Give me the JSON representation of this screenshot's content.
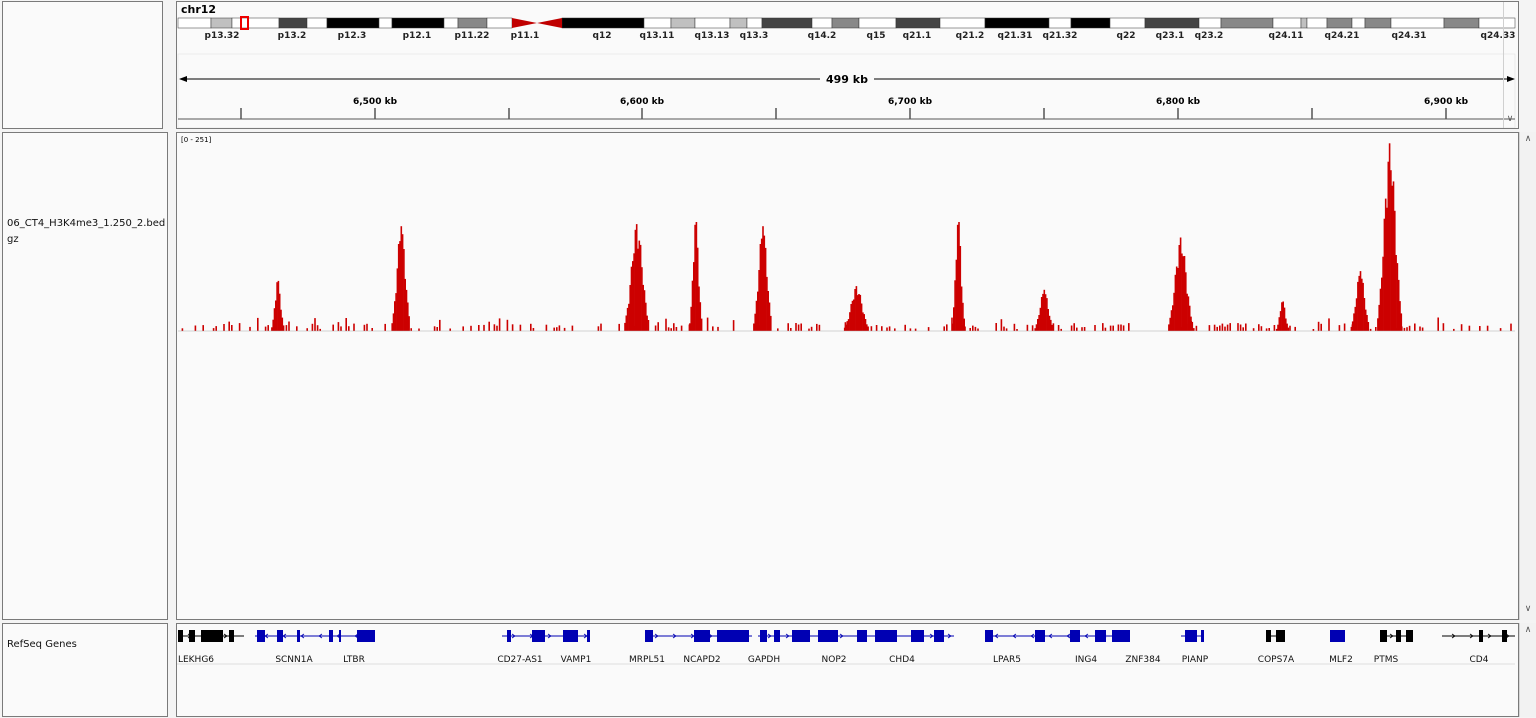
{
  "chromosome": "chr12",
  "ideogram": {
    "labels": [
      "p13.32",
      "p13.2",
      "p12.3",
      "p12.1",
      "p11.22",
      "p11.1",
      "q12",
      "q13.11",
      "q13.13",
      "q13.3",
      "q14.2",
      "q15",
      "q21.1",
      "q21.2",
      "q21.31",
      "q21.32",
      "q22",
      "q23.1",
      "q23.2",
      "q24.11",
      "q24.21",
      "q24.31",
      "q24.33"
    ]
  },
  "ruler": {
    "span_label": "499 kb",
    "ticks": [
      "6,500 kb",
      "6,600 kb",
      "6,700 kb",
      "6,800 kb",
      "6,900 kb"
    ]
  },
  "track": {
    "name_line1": "06_CT4_H3K4me3_1.250_2.bed",
    "name_line2": "gz",
    "range_label": "[0 - 251]",
    "color": "#cc0000",
    "max_value": 251
  },
  "genes_track": {
    "name": "RefSeq Genes",
    "color_coding": "#0000b3",
    "color_noncoding": "#000000",
    "genes": [
      "LEKHG6",
      "SCNN1A",
      "LTBR",
      "CD27-AS1",
      "VAMP1",
      "MRPL51",
      "NCAPD2",
      "GAPDH",
      "NOP2",
      "CHD4",
      "LPAR5",
      "ING4",
      "ZNF384",
      "PIANP",
      "COPS7A",
      "MLF2",
      "PTMS",
      "CD4"
    ]
  },
  "chart_data": {
    "type": "bar",
    "title": "",
    "xlabel": "",
    "ylabel": "",
    "ylim": [
      0,
      251
    ],
    "x_unit": "kb",
    "x": [
      6463,
      6509,
      6597,
      6619,
      6644,
      6679,
      6717,
      6749,
      6800,
      6838,
      6867,
      6878
    ],
    "values": [
      68,
      140,
      143,
      148,
      140,
      60,
      148,
      55,
      125,
      40,
      80,
      251
    ]
  }
}
